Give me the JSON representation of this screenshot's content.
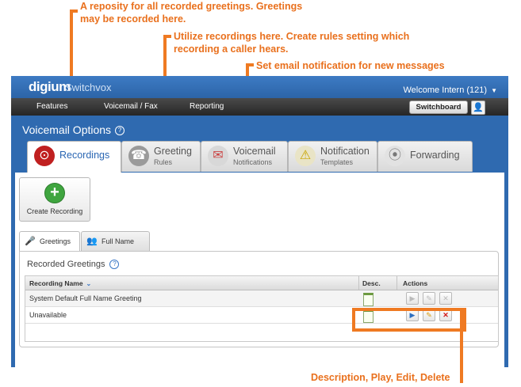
{
  "annotations": {
    "top": "A reposity for all recorded greetings. Greetings\nmay be recorded here.",
    "rules": "Utilize recordings here. Create rules setting which\nrecording a caller hears.",
    "notify": "Set email notification for new messages",
    "actions": "Description, Play, Edit, Delete",
    "color": "#e9701d"
  },
  "header": {
    "logo": "digium",
    "logo_sub": "Switchvox",
    "welcome": "Welcome Intern (121)"
  },
  "menu": {
    "items": [
      "Features",
      "Voicemail / Fax",
      "Reporting"
    ],
    "switchboard": "Switchboard"
  },
  "page_title": "Voicemail Options",
  "tabs": [
    {
      "label": "Recordings",
      "sub": "",
      "icon": "recordings-icon",
      "active": true
    },
    {
      "label": "Greeting",
      "sub": "Rules",
      "icon": "greeting-rules-icon",
      "active": false
    },
    {
      "label": "Voicemail",
      "sub": "Notifications",
      "icon": "voicemail-notifications-icon",
      "active": false
    },
    {
      "label": "Notification",
      "sub": "Templates",
      "icon": "notification-templates-icon",
      "active": false
    },
    {
      "label": "Forwarding",
      "sub": "",
      "icon": "forwarding-icon",
      "active": false
    }
  ],
  "create_button": "Create Recording",
  "subtabs": [
    {
      "label": "Greetings",
      "active": true
    },
    {
      "label": "Full Name",
      "active": false
    }
  ],
  "panel_title": "Recorded Greetings",
  "table": {
    "columns": [
      "Recording Name",
      "Desc.",
      "Actions"
    ],
    "rows": [
      {
        "name": "System Default Full Name Greeting",
        "actions_enabled": false
      },
      {
        "name": "Unavailable",
        "actions_enabled": true
      }
    ]
  }
}
